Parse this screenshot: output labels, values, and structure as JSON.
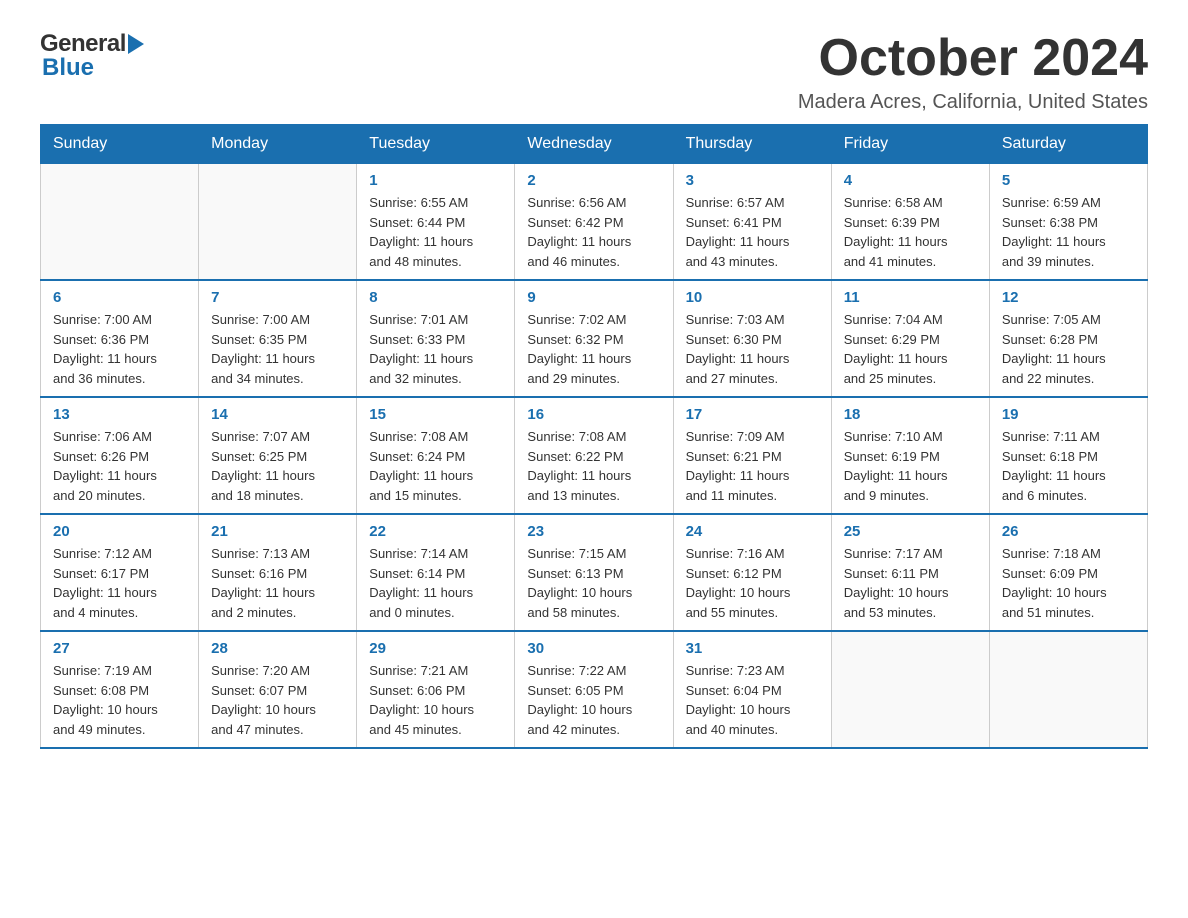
{
  "header": {
    "logo_general": "General",
    "logo_blue": "Blue",
    "month_title": "October 2024",
    "location": "Madera Acres, California, United States"
  },
  "days_of_week": [
    "Sunday",
    "Monday",
    "Tuesday",
    "Wednesday",
    "Thursday",
    "Friday",
    "Saturday"
  ],
  "weeks": [
    [
      {
        "day": "",
        "info": ""
      },
      {
        "day": "",
        "info": ""
      },
      {
        "day": "1",
        "info": "Sunrise: 6:55 AM\nSunset: 6:44 PM\nDaylight: 11 hours\nand 48 minutes."
      },
      {
        "day": "2",
        "info": "Sunrise: 6:56 AM\nSunset: 6:42 PM\nDaylight: 11 hours\nand 46 minutes."
      },
      {
        "day": "3",
        "info": "Sunrise: 6:57 AM\nSunset: 6:41 PM\nDaylight: 11 hours\nand 43 minutes."
      },
      {
        "day": "4",
        "info": "Sunrise: 6:58 AM\nSunset: 6:39 PM\nDaylight: 11 hours\nand 41 minutes."
      },
      {
        "day": "5",
        "info": "Sunrise: 6:59 AM\nSunset: 6:38 PM\nDaylight: 11 hours\nand 39 minutes."
      }
    ],
    [
      {
        "day": "6",
        "info": "Sunrise: 7:00 AM\nSunset: 6:36 PM\nDaylight: 11 hours\nand 36 minutes."
      },
      {
        "day": "7",
        "info": "Sunrise: 7:00 AM\nSunset: 6:35 PM\nDaylight: 11 hours\nand 34 minutes."
      },
      {
        "day": "8",
        "info": "Sunrise: 7:01 AM\nSunset: 6:33 PM\nDaylight: 11 hours\nand 32 minutes."
      },
      {
        "day": "9",
        "info": "Sunrise: 7:02 AM\nSunset: 6:32 PM\nDaylight: 11 hours\nand 29 minutes."
      },
      {
        "day": "10",
        "info": "Sunrise: 7:03 AM\nSunset: 6:30 PM\nDaylight: 11 hours\nand 27 minutes."
      },
      {
        "day": "11",
        "info": "Sunrise: 7:04 AM\nSunset: 6:29 PM\nDaylight: 11 hours\nand 25 minutes."
      },
      {
        "day": "12",
        "info": "Sunrise: 7:05 AM\nSunset: 6:28 PM\nDaylight: 11 hours\nand 22 minutes."
      }
    ],
    [
      {
        "day": "13",
        "info": "Sunrise: 7:06 AM\nSunset: 6:26 PM\nDaylight: 11 hours\nand 20 minutes."
      },
      {
        "day": "14",
        "info": "Sunrise: 7:07 AM\nSunset: 6:25 PM\nDaylight: 11 hours\nand 18 minutes."
      },
      {
        "day": "15",
        "info": "Sunrise: 7:08 AM\nSunset: 6:24 PM\nDaylight: 11 hours\nand 15 minutes."
      },
      {
        "day": "16",
        "info": "Sunrise: 7:08 AM\nSunset: 6:22 PM\nDaylight: 11 hours\nand 13 minutes."
      },
      {
        "day": "17",
        "info": "Sunrise: 7:09 AM\nSunset: 6:21 PM\nDaylight: 11 hours\nand 11 minutes."
      },
      {
        "day": "18",
        "info": "Sunrise: 7:10 AM\nSunset: 6:19 PM\nDaylight: 11 hours\nand 9 minutes."
      },
      {
        "day": "19",
        "info": "Sunrise: 7:11 AM\nSunset: 6:18 PM\nDaylight: 11 hours\nand 6 minutes."
      }
    ],
    [
      {
        "day": "20",
        "info": "Sunrise: 7:12 AM\nSunset: 6:17 PM\nDaylight: 11 hours\nand 4 minutes."
      },
      {
        "day": "21",
        "info": "Sunrise: 7:13 AM\nSunset: 6:16 PM\nDaylight: 11 hours\nand 2 minutes."
      },
      {
        "day": "22",
        "info": "Sunrise: 7:14 AM\nSunset: 6:14 PM\nDaylight: 11 hours\nand 0 minutes."
      },
      {
        "day": "23",
        "info": "Sunrise: 7:15 AM\nSunset: 6:13 PM\nDaylight: 10 hours\nand 58 minutes."
      },
      {
        "day": "24",
        "info": "Sunrise: 7:16 AM\nSunset: 6:12 PM\nDaylight: 10 hours\nand 55 minutes."
      },
      {
        "day": "25",
        "info": "Sunrise: 7:17 AM\nSunset: 6:11 PM\nDaylight: 10 hours\nand 53 minutes."
      },
      {
        "day": "26",
        "info": "Sunrise: 7:18 AM\nSunset: 6:09 PM\nDaylight: 10 hours\nand 51 minutes."
      }
    ],
    [
      {
        "day": "27",
        "info": "Sunrise: 7:19 AM\nSunset: 6:08 PM\nDaylight: 10 hours\nand 49 minutes."
      },
      {
        "day": "28",
        "info": "Sunrise: 7:20 AM\nSunset: 6:07 PM\nDaylight: 10 hours\nand 47 minutes."
      },
      {
        "day": "29",
        "info": "Sunrise: 7:21 AM\nSunset: 6:06 PM\nDaylight: 10 hours\nand 45 minutes."
      },
      {
        "day": "30",
        "info": "Sunrise: 7:22 AM\nSunset: 6:05 PM\nDaylight: 10 hours\nand 42 minutes."
      },
      {
        "day": "31",
        "info": "Sunrise: 7:23 AM\nSunset: 6:04 PM\nDaylight: 10 hours\nand 40 minutes."
      },
      {
        "day": "",
        "info": ""
      },
      {
        "day": "",
        "info": ""
      }
    ]
  ]
}
